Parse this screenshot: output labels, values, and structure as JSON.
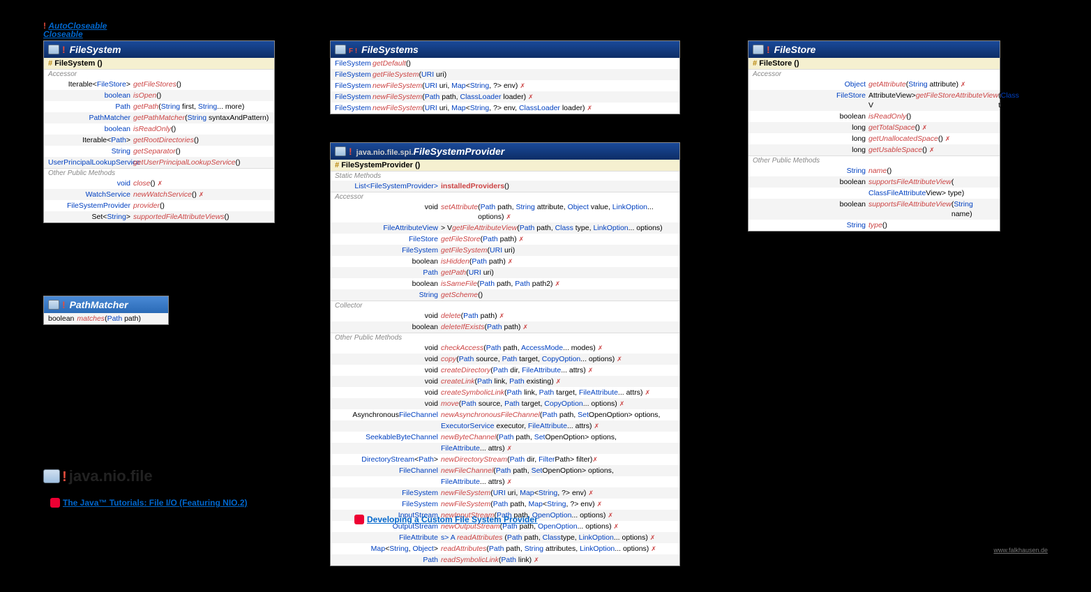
{
  "top": {
    "auto": "AutoCloseable",
    "close": "Closeable"
  },
  "fs": {
    "title": "FileSystem",
    "ctor": "FileSystem ()",
    "acc": "Accessor",
    "r": [
      {
        "ret": [
          "Iterable<",
          "FileStore",
          ">"
        ],
        "m": "getFileStores",
        "p": "()"
      },
      {
        "ret": [
          "",
          "boolean",
          ""
        ],
        "m": "isOpen",
        "p": "()"
      },
      {
        "ret": [
          "",
          "Path",
          ""
        ],
        "m": "getPath",
        "p": "(String first, String... more)"
      },
      {
        "ret": [
          "",
          "PathMatcher",
          ""
        ],
        "m": "getPathMatcher",
        "p": "(String syntaxAndPattern)"
      },
      {
        "ret": [
          "",
          "boolean",
          ""
        ],
        "m": "isReadOnly",
        "p": "()"
      },
      {
        "ret": [
          "Iterable<",
          "Path",
          ">"
        ],
        "m": "getRootDirectories",
        "p": "()"
      },
      {
        "ret": [
          "",
          "String",
          ""
        ],
        "m": "getSeparator",
        "p": "()"
      },
      {
        "ret": [
          "",
          "UserPrincipalLookupService",
          ""
        ],
        "m": "getUserPrincipalLookupService",
        "p": "()"
      }
    ],
    "oth": "Other Public Methods",
    "r2": [
      {
        "ret": [
          "",
          "void",
          ""
        ],
        "m": "close",
        "p": "() ",
        "e": "✗"
      },
      {
        "ret": [
          "",
          "WatchService",
          ""
        ],
        "m": "newWatchService",
        "p": "() ",
        "e": "✗"
      },
      {
        "ret": [
          "",
          "FileSystemProvider",
          ""
        ],
        "m": "provider",
        "p": "()"
      },
      {
        "ret": [
          "Set<",
          "String",
          ">"
        ],
        "m": "supportedFileAttributeViews",
        "p": "()"
      }
    ]
  },
  "pm": {
    "title": "PathMatcher",
    "r": {
      "ret": "boolean",
      "m": "matches",
      "p": "(Path path)"
    }
  },
  "pkg": {
    "bang": "!",
    "name": "java.nio.file",
    "tut": "The Java™ Tutorials: File I/O (Featuring NIO.2)"
  },
  "fss": {
    "title": "FileSystems",
    "r": [
      {
        "ret": "FileSystem",
        "m": "getDefault",
        "p": "()"
      },
      {
        "ret": "FileSystem",
        "m": "getFileSystem",
        "p": "(URI uri)"
      },
      {
        "ret": "FileSystem",
        "m": "newFileSystem",
        "p": "(URI uri, Map<String, ?> env) ",
        "e": "✗"
      },
      {
        "ret": "FileSystem",
        "m": "newFileSystem",
        "p": "(Path path, ClassLoader loader) ",
        "e": "✗"
      },
      {
        "ret": "FileSystem",
        "m": "newFileSystem",
        "p": "(URI uri, Map<String, ?> env, ClassLoader loader) ",
        "e": "✗"
      }
    ]
  },
  "fsp": {
    "pkg": "java.nio.file.spi.",
    "title": "FileSystemProvider",
    "ctor": "FileSystemProvider ()",
    "sm": "Static Methods",
    "smr": {
      "ret": "List<FileSystemProvider>",
      "m": "installedProviders",
      "p": "()"
    },
    "acc": "Accessor",
    "ar": [
      {
        "ret": "void",
        "m": "setAttribute",
        "p": "(Path path, String attribute, Object value, LinkOption... options) ",
        "e": "✗"
      },
      {
        "ret": "<V extends FileAttributeView> V",
        "m": "getFileAttributeView",
        "p": "(Path path, Class<V> type, LinkOption... options)"
      },
      {
        "ret": "FileStore",
        "m": "getFileStore",
        "p": "(Path path) ",
        "e": "✗"
      },
      {
        "ret": "FileSystem",
        "m": "getFileSystem",
        "p": "(URI uri)"
      },
      {
        "ret": "boolean",
        "m": "isHidden",
        "p": "(Path path) ",
        "e": "✗"
      },
      {
        "ret": "Path",
        "m": "getPath",
        "p": "(URI uri)"
      },
      {
        "ret": "boolean",
        "m": "isSameFile",
        "p": "(Path path, Path path2) ",
        "e": "✗"
      },
      {
        "ret": "String",
        "m": "getScheme",
        "p": "()"
      }
    ],
    "col": "Collector",
    "cr": [
      {
        "ret": "void",
        "m": "delete",
        "p": "(Path path) ",
        "e": "✗"
      },
      {
        "ret": "boolean",
        "m": "deleteIfExists",
        "p": "(Path path) ",
        "e": "✗"
      }
    ],
    "oth": "Other Public Methods",
    "or": [
      {
        "ret": "void",
        "m": "checkAccess",
        "p": "(Path path, AccessMode... modes) ",
        "e": "✗"
      },
      {
        "ret": "void",
        "m": "copy",
        "p": "(Path source, Path target, CopyOption... options) ",
        "e": "✗"
      },
      {
        "ret": "void",
        "m": "createDirectory",
        "p": "(Path dir, FileAttribute<?>... attrs) ",
        "e": "✗"
      },
      {
        "ret": "void",
        "m": "createLink",
        "p": "(Path link, Path existing) ",
        "e": "✗"
      },
      {
        "ret": "void",
        "m": "createSymbolicLink",
        "p": "(Path link, Path target, FileAttribute<?>... attrs) ",
        "e": "✗"
      },
      {
        "ret": "void",
        "m": "move",
        "p": "(Path source, Path target, CopyOption... options) ",
        "e": "✗"
      },
      {
        "ret": "AsynchronousFileChannel",
        "m": "newAsynchronousFileChannel",
        "p": "(Path path, Set<? extends OpenOption> options,"
      },
      {
        "ret": "",
        "m": "",
        "p": "ExecutorService executor, FileAttribute<?>... attrs) ",
        "e": "✗"
      },
      {
        "ret": "SeekableByteChannel",
        "m": "newByteChannel",
        "p": "(Path path, Set<? extends OpenOption> options,"
      },
      {
        "ret": "",
        "m": "",
        "p": "FileAttribute<?>... attrs) ",
        "e": "✗"
      },
      {
        "ret": "DirectoryStream<Path>",
        "m": "newDirectoryStream",
        "p": "(Path dir, Filter<? super Path> filter) ",
        "e": "✗"
      },
      {
        "ret": "FileChannel",
        "m": "newFileChannel",
        "p": "(Path path, Set<? extends OpenOption> options,"
      },
      {
        "ret": "",
        "m": "",
        "p": "FileAttribute<?>... attrs) ",
        "e": "✗"
      },
      {
        "ret": "FileSystem",
        "m": "newFileSystem",
        "p": "(URI uri, Map<String, ?> env) ",
        "e": "✗"
      },
      {
        "ret": "FileSystem",
        "m": "newFileSystem",
        "p": "(Path path, Map<String, ?> env) ",
        "e": "✗"
      },
      {
        "ret": "InputStream",
        "m": "newInputStream",
        "p": "(Path path, OpenOption... options) ",
        "e": "✗"
      },
      {
        "ret": "OutputStream",
        "m": "newOutputStream",
        "p": "(Path path, OpenOption... options) ",
        "e": "✗"
      },
      {
        "ret": "<A extends BasicFileAttributes> A",
        "m": "readAttributes",
        "p": "(Path path, Class<A> type, LinkOption... options) ",
        "e": "✗"
      },
      {
        "ret": "Map<String, Object>",
        "m": "readAttributes",
        "p": "(Path path, String attributes, LinkOption... options) ",
        "e": "✗"
      },
      {
        "ret": "Path",
        "m": "readSymbolicLink",
        "p": "(Path link) ",
        "e": "✗"
      }
    ]
  },
  "cust": "Developing a Custom File System Provider",
  "fst": {
    "title": "FileStore",
    "ctor": "FileStore ()",
    "acc": "Accessor",
    "ar": [
      {
        "ret": "Object",
        "m": "getAttribute",
        "p": "(String attribute) ",
        "e": "✗"
      },
      {
        "ret": "<V extends FileStoreAttributeView> V",
        "m": "getFileStoreAttributeView",
        "p": "(Class<V> type)"
      },
      {
        "ret": "boolean",
        "m": "isReadOnly",
        "p": "()"
      },
      {
        "ret": "long",
        "m": "getTotalSpace",
        "p": "() ",
        "e": "✗"
      },
      {
        "ret": "long",
        "m": "getUnallocatedSpace",
        "p": "() ",
        "e": "✗"
      },
      {
        "ret": "long",
        "m": "getUsableSpace",
        "p": "() ",
        "e": "✗"
      }
    ],
    "oth": "Other Public Methods",
    "or": [
      {
        "ret": "String",
        "m": "name",
        "p": "()"
      },
      {
        "ret": "boolean",
        "m": "supportsFileAttributeView",
        "p": "("
      },
      {
        "ret": "",
        "m": "",
        "p": "Class<? extends FileAttributeView> type)"
      },
      {
        "ret": "boolean",
        "m": "supportsFileAttributeView",
        "p": "(String name)"
      },
      {
        "ret": "String",
        "m": "type",
        "p": "()"
      }
    ]
  },
  "ftr": "www.falkhausen.de"
}
